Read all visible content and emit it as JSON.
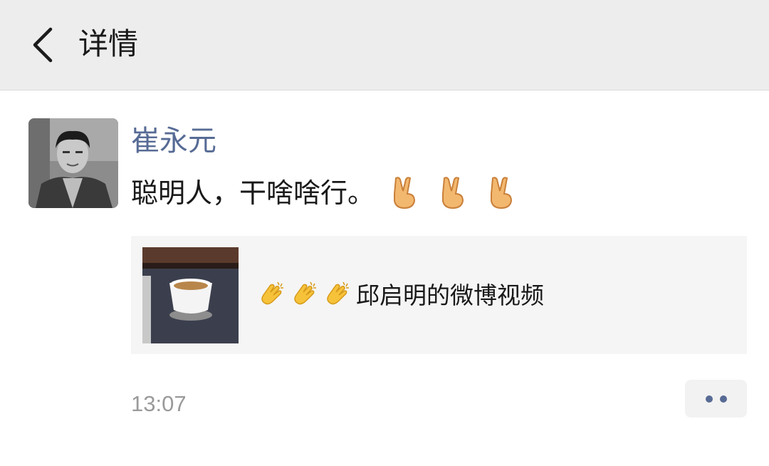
{
  "header": {
    "title": "详情",
    "back_icon": "chevron-left-icon"
  },
  "post": {
    "author": "崔永元",
    "text": "聪明人，干啥啥行。",
    "text_emojis": [
      "victory-hand-icon",
      "victory-hand-icon",
      "victory-hand-icon"
    ],
    "time": "13:07"
  },
  "shared_link": {
    "emojis": [
      "clapping-hands-icon",
      "clapping-hands-icon",
      "clapping-hands-icon"
    ],
    "title": "邱启明的微博视频"
  },
  "colors": {
    "name_link": "#576b95",
    "header_bg": "#ededed",
    "card_bg": "#f5f5f5"
  }
}
